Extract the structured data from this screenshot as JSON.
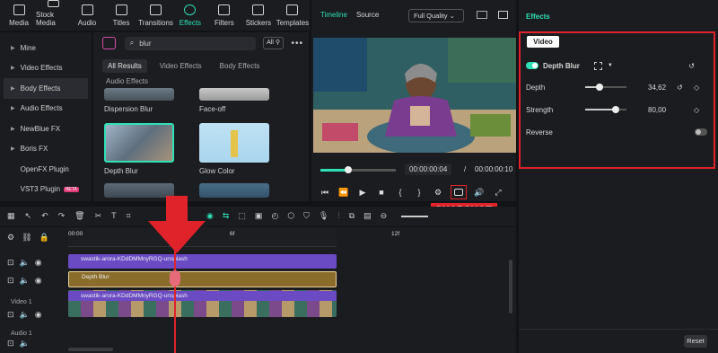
{
  "toolbar": {
    "items": [
      {
        "label": "Media",
        "icon": "media-icon"
      },
      {
        "label": "Stock Media",
        "icon": "stock-media-icon"
      },
      {
        "label": "Audio",
        "icon": "audio-icon"
      },
      {
        "label": "Titles",
        "icon": "titles-icon"
      },
      {
        "label": "Transitions",
        "icon": "transitions-icon"
      },
      {
        "label": "Effects",
        "icon": "effects-icon",
        "active": true
      },
      {
        "label": "Filters",
        "icon": "filters-icon"
      },
      {
        "label": "Stickers",
        "icon": "stickers-icon"
      },
      {
        "label": "Templates",
        "icon": "templates-icon"
      }
    ]
  },
  "sidebar": {
    "items": [
      {
        "label": "Mine"
      },
      {
        "label": "Video Effects"
      },
      {
        "label": "Body Effects",
        "selected": true
      },
      {
        "label": "Audio Effects"
      },
      {
        "label": "NewBlue FX"
      },
      {
        "label": "Boris FX"
      },
      {
        "label": "OpenFX Plugin"
      },
      {
        "label": "VST3 Plugin",
        "badge": "BETA"
      }
    ]
  },
  "content": {
    "search_value": "blur",
    "filter_label": "All",
    "tabs": [
      "All Results",
      "Video Effects",
      "Body Effects"
    ],
    "tab2": "Audio Effects",
    "cards": [
      "Dispersion Blur",
      "Face-off",
      "Depth Blur",
      "Glow Color"
    ]
  },
  "preview": {
    "tabs": [
      "Timeline",
      "Source"
    ],
    "quality": "Full Quality",
    "current_time": "00:00:00:04",
    "separator": "/",
    "total_time": "00:00:00:10"
  },
  "annotation": {
    "label": "SNAPSHOT"
  },
  "props": {
    "title": "Effects",
    "video_tab": "Video",
    "effect_name": "Depth Blur",
    "depth_label": "Depth",
    "depth_value": "34,62",
    "strength_label": "Strength",
    "strength_value": "80,00",
    "reverse_label": "Reverse",
    "reset_label": "Reset"
  },
  "timeline": {
    "ruler": [
      "00:00",
      "6f",
      "12f"
    ],
    "track1_clip": "swastik-arora-KDdDMMnyRGQ-unsplash",
    "effect_clip": "Depth Blur",
    "video_clip": "swastik-arora-KDdDMMnyRGQ-unsplash",
    "video_track_label": "Video 1",
    "audio_track_label": "Audio 1"
  },
  "colors": {
    "accent": "#2fe0b6",
    "highlight": "#e0222a",
    "clip_purple": "#6a4bc4",
    "clip_gold": "#8a6d2a"
  }
}
